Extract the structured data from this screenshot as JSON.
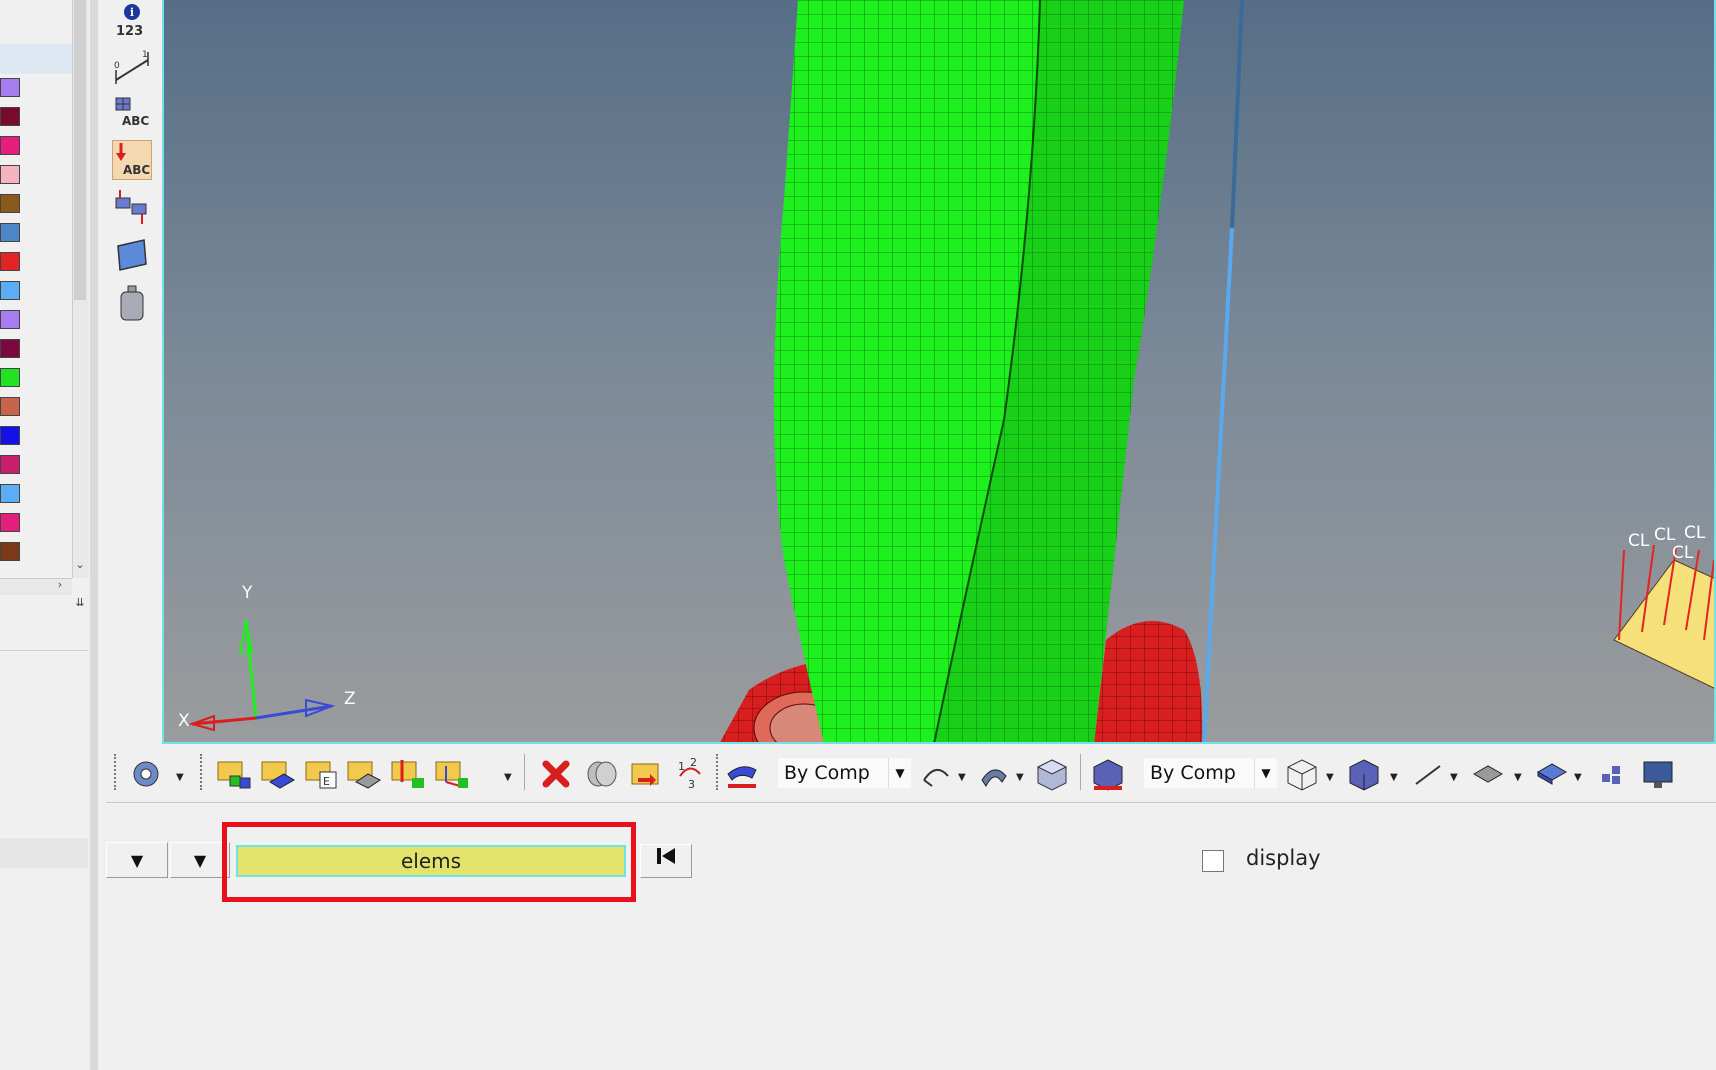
{
  "left_panel": {
    "swatch_colors": [
      "#a77cf0",
      "#7a0a2c",
      "#e51e7e",
      "#f5b3c0",
      "#8a5a1a",
      "#4a86c8",
      "#e32424",
      "#5aaef5",
      "#a77cf0",
      "#7a0a3e",
      "#22e322",
      "#c8644a",
      "#1212e8",
      "#c81e6e",
      "#5aaef5",
      "#e51e7e",
      "#7a3a1a"
    ]
  },
  "vertical_toolbar": {
    "info_count_label": "123",
    "abc_label": "ABC",
    "abc_active_label": "ABC"
  },
  "viewport": {
    "axis_y": "Y",
    "axis_x": "X",
    "axis_z": "Z",
    "constraint_label": "CL",
    "colors": {
      "mesh_green": "#1ef01e",
      "mesh_red": "#d81e1e",
      "beam_blue": "#5aa8ee",
      "load_yellow": "#f5e07a"
    }
  },
  "toolbar": {
    "color_mode_1": "By Comp",
    "color_mode_2": "By Comp"
  },
  "panel": {
    "selector_value": "elems",
    "display_label": "display",
    "display_checked": false
  }
}
